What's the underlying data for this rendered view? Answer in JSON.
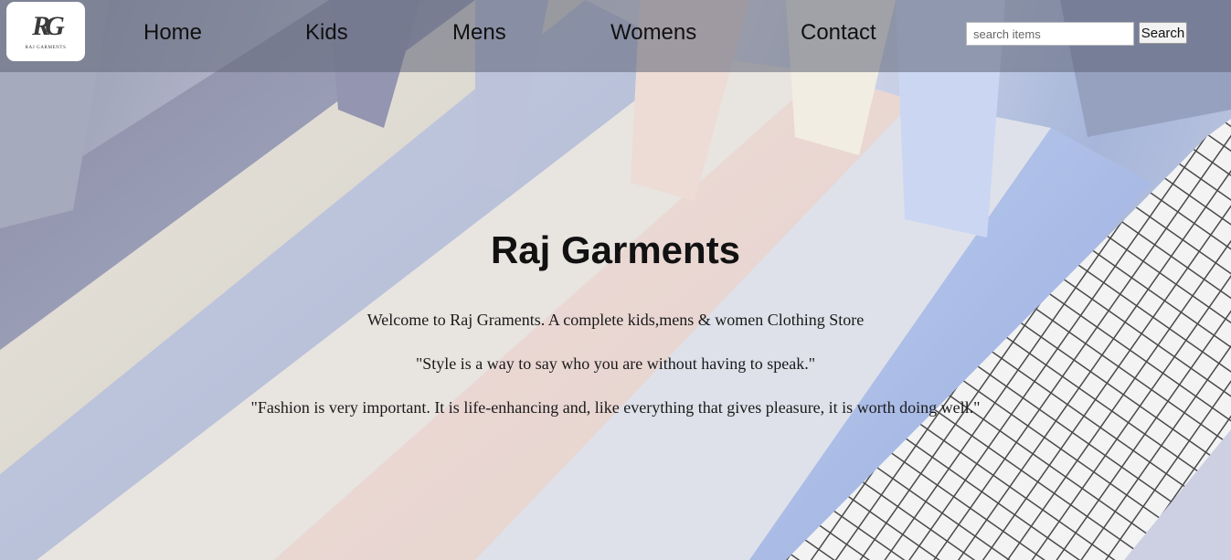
{
  "logo": {
    "mark": "RG",
    "text": "RAJ GARMENTS"
  },
  "nav": {
    "home": "Home",
    "kids": "Kids",
    "mens": "Mens",
    "womens": "Womens",
    "contact": "Contact"
  },
  "search": {
    "placeholder": "search items",
    "button_label": "Search"
  },
  "main": {
    "title": "Raj Garments",
    "welcome": "Welcome to Raj Graments. A complete kids,mens & women Clothing Store",
    "quote1": "\"Style is a way to say who you are without having to speak.\"",
    "quote2": "\"Fashion is very important. It is life-enhancing and, like everything that gives pleasure, it is worth doing well.\""
  }
}
